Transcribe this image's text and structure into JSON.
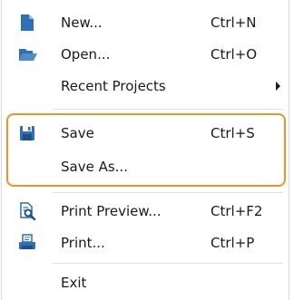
{
  "menu": {
    "items": [
      {
        "label": "New...",
        "shortcut": "Ctrl+N",
        "icon": "new-file-icon"
      },
      {
        "label": "Open...",
        "shortcut": "Ctrl+O",
        "icon": "open-folder-icon"
      },
      {
        "label": "Recent Projects",
        "shortcut": "",
        "icon": "",
        "submenu": true
      },
      {
        "label": "Save",
        "shortcut": "Ctrl+S",
        "icon": "save-icon"
      },
      {
        "label": "Save As...",
        "shortcut": "",
        "icon": ""
      },
      {
        "label": "Print Preview...",
        "shortcut": "Ctrl+F2",
        "icon": "print-preview-icon"
      },
      {
        "label": "Print...",
        "shortcut": "Ctrl+P",
        "icon": "printer-icon"
      },
      {
        "label": "Exit",
        "shortcut": "",
        "icon": ""
      }
    ]
  },
  "colors": {
    "icon_blue": "#2f6fb6",
    "highlight_border": "#f0922b",
    "separator": "#e0e0e0",
    "text": "#1a1a1a"
  }
}
